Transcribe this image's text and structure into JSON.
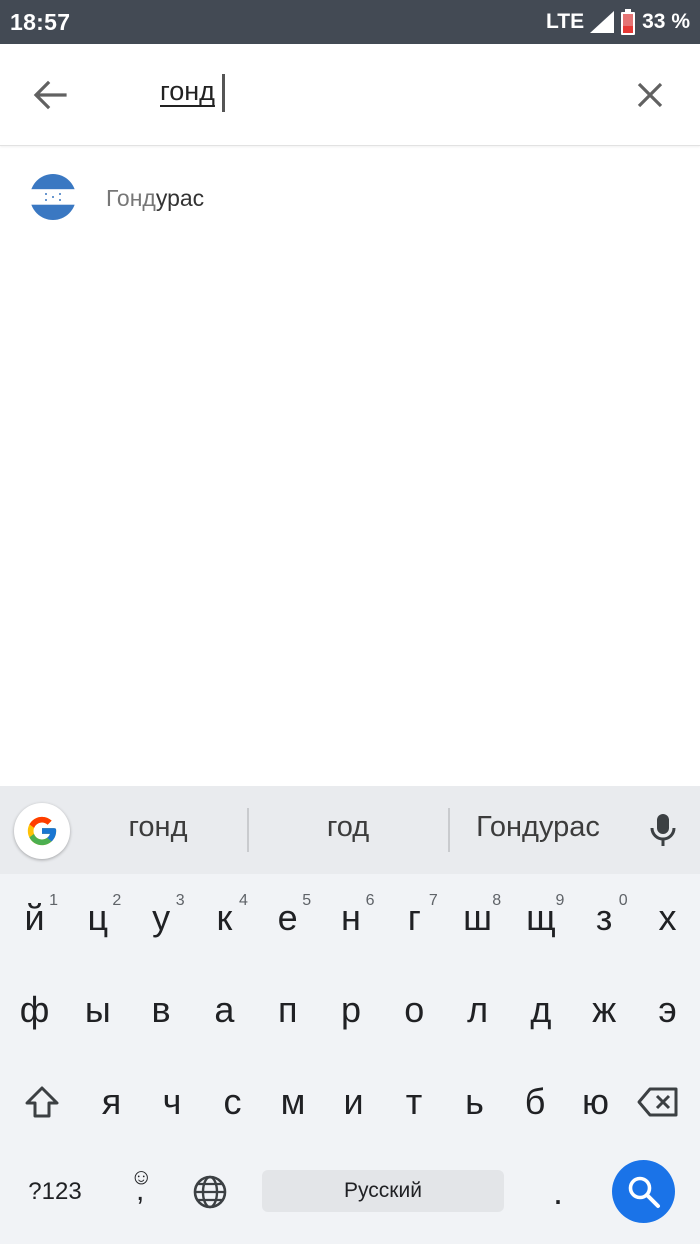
{
  "status_bar": {
    "time": "18:57",
    "network": "LTE",
    "battery": "33 %",
    "icons": [
      "signal-icon",
      "battery-icon"
    ]
  },
  "search": {
    "query": "гонд",
    "icons": [
      "back-arrow-icon",
      "close-icon"
    ]
  },
  "results": [
    {
      "label_match": "Гонд",
      "label_rest": "урас",
      "icon": "honduras-flag-icon"
    }
  ],
  "keyboard": {
    "suggestions": [
      "гонд",
      "год",
      "Гондурас"
    ],
    "row1": [
      {
        "key": "й",
        "hint": "1"
      },
      {
        "key": "ц",
        "hint": "2"
      },
      {
        "key": "у",
        "hint": "3"
      },
      {
        "key": "к",
        "hint": "4"
      },
      {
        "key": "е",
        "hint": "5"
      },
      {
        "key": "н",
        "hint": "6"
      },
      {
        "key": "г",
        "hint": "7"
      },
      {
        "key": "ш",
        "hint": "8"
      },
      {
        "key": "щ",
        "hint": "9"
      },
      {
        "key": "з",
        "hint": "0"
      },
      {
        "key": "х",
        "hint": ""
      }
    ],
    "row2": [
      "ф",
      "ы",
      "в",
      "а",
      "п",
      "р",
      "о",
      "л",
      "д",
      "ж",
      "э"
    ],
    "row3": [
      "я",
      "ч",
      "с",
      "м",
      "и",
      "т",
      "ь",
      "б",
      "ю"
    ],
    "symbols_label": "?123",
    "comma_label": ",",
    "space_label": "Русский",
    "period_label": ".",
    "accent_color": "#1A73E8"
  }
}
